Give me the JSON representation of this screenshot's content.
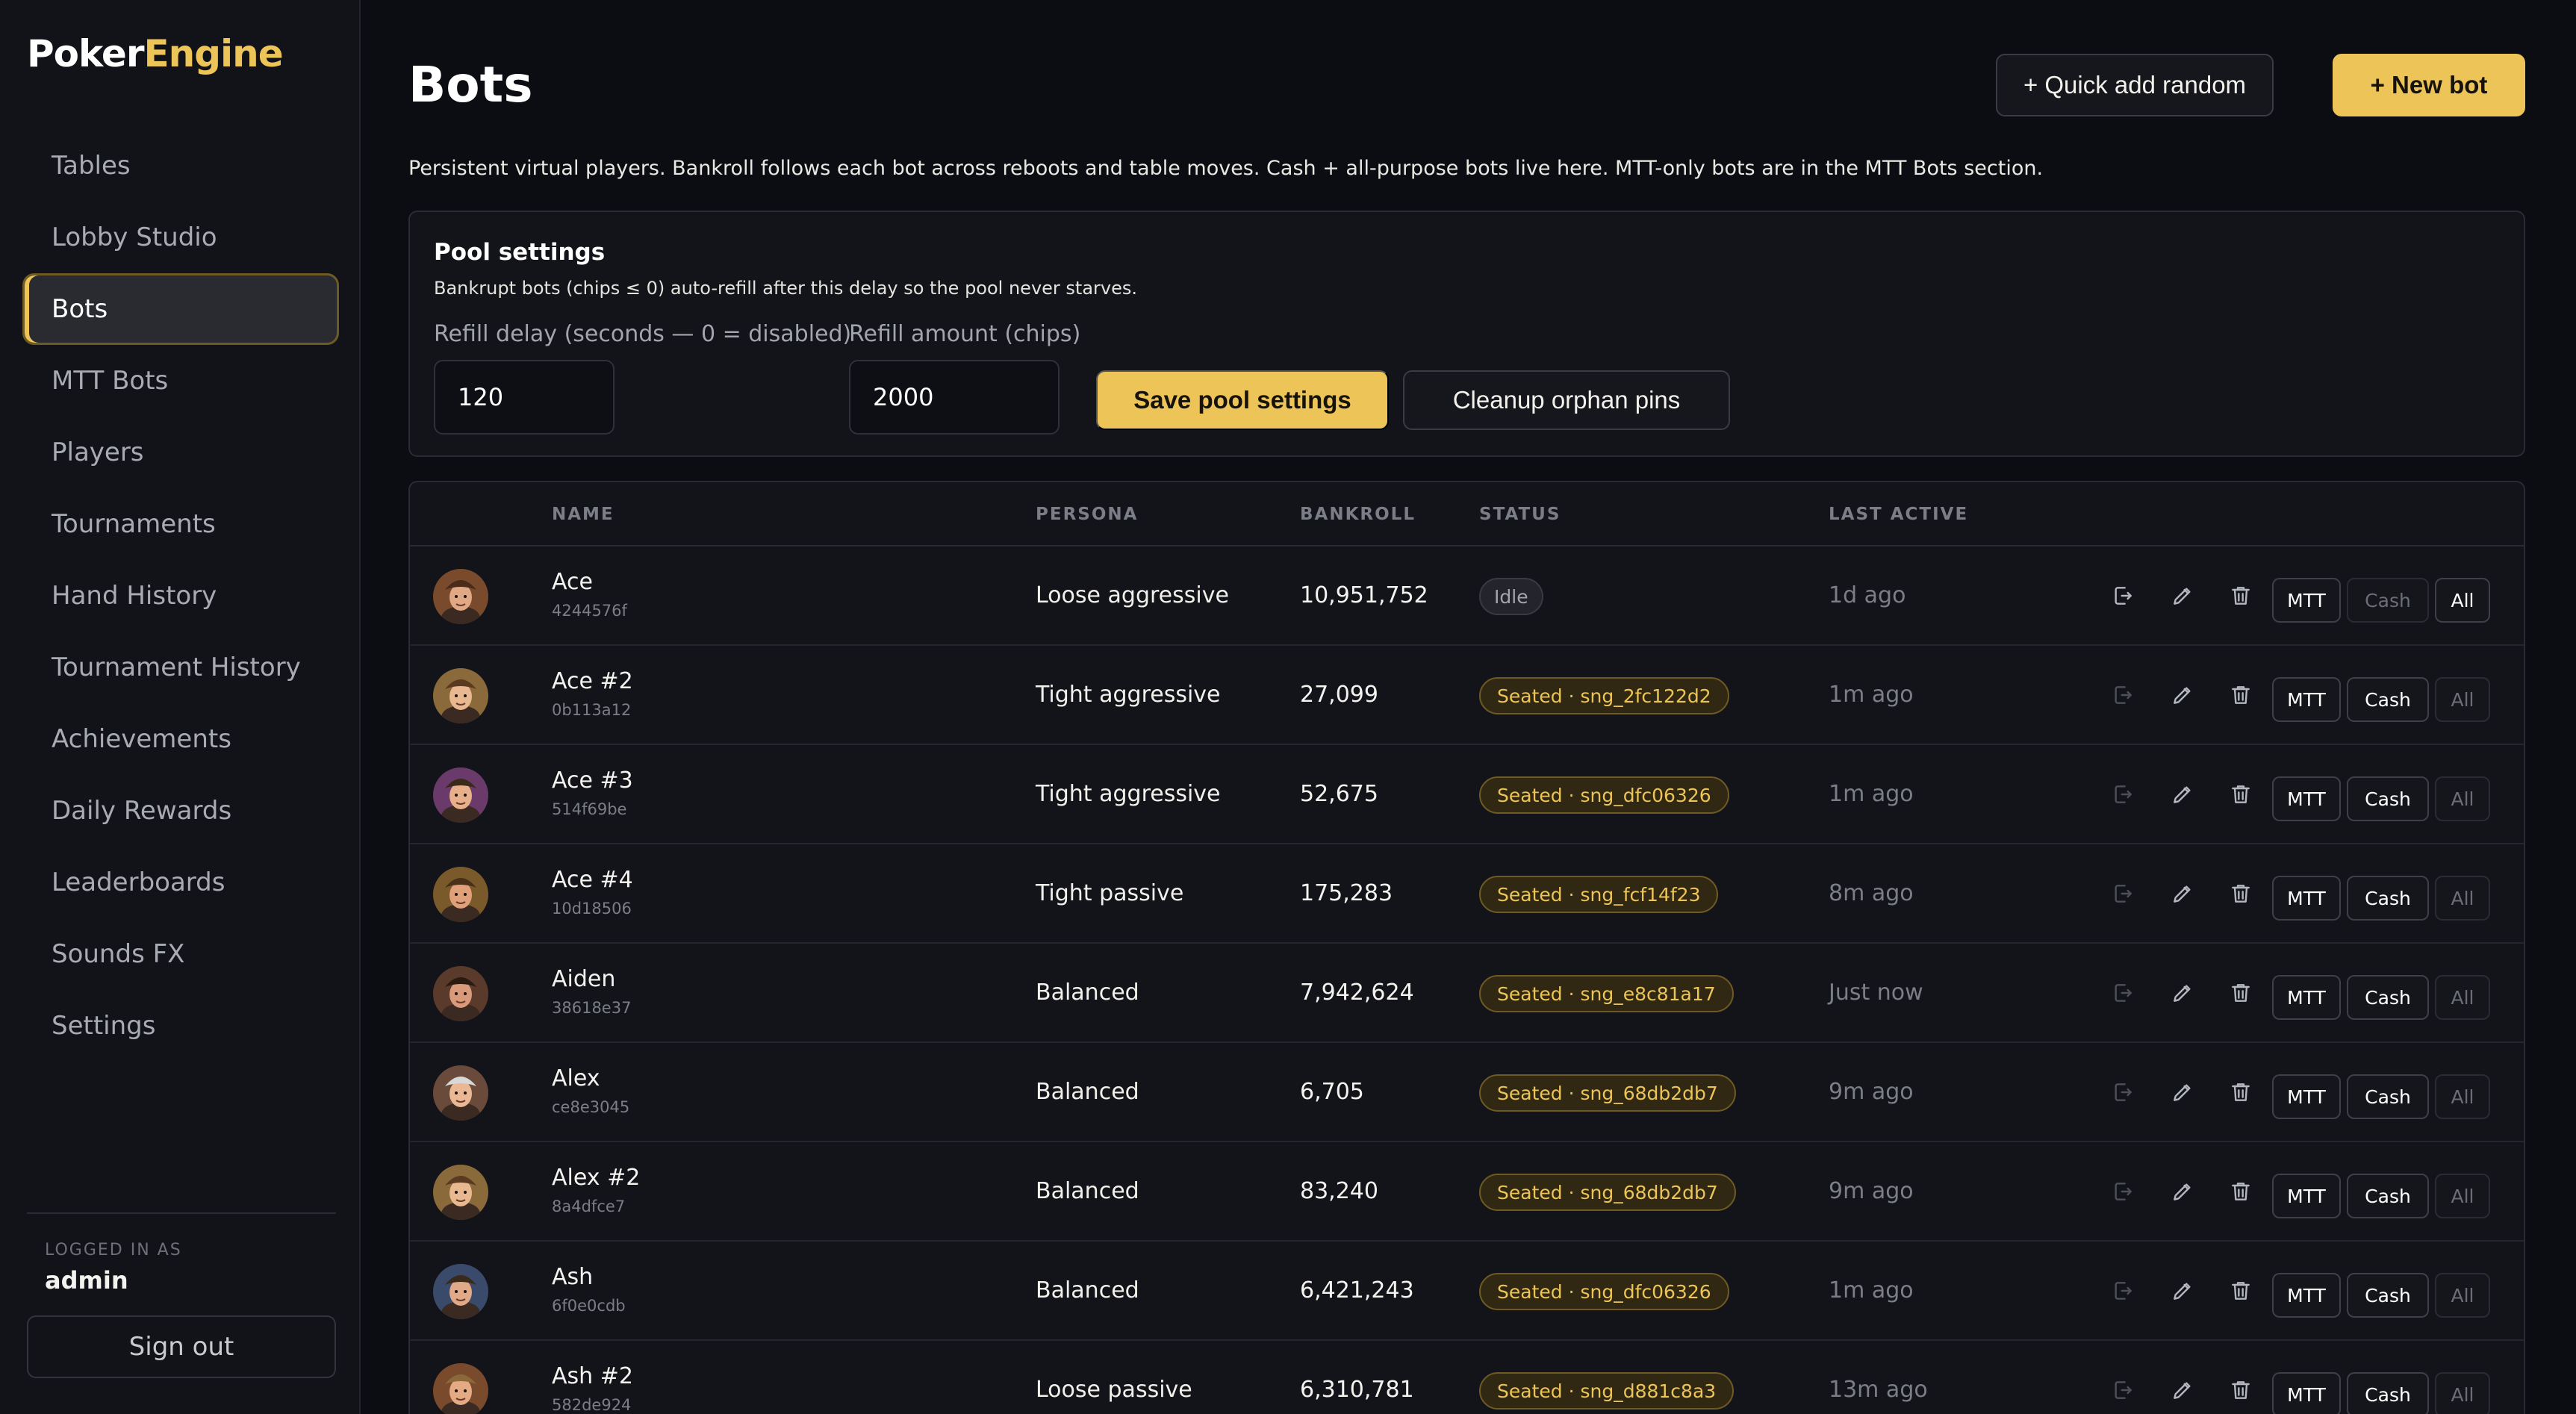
{
  "brand": {
    "part1": "Poker",
    "part2": "Engine"
  },
  "sidebar": {
    "items": [
      {
        "label": "Tables",
        "active": false
      },
      {
        "label": "Lobby Studio",
        "active": false
      },
      {
        "label": "Bots",
        "active": true
      },
      {
        "label": "MTT Bots",
        "active": false
      },
      {
        "label": "Players",
        "active": false
      },
      {
        "label": "Tournaments",
        "active": false
      },
      {
        "label": "Hand History",
        "active": false
      },
      {
        "label": "Tournament History",
        "active": false
      },
      {
        "label": "Achievements",
        "active": false
      },
      {
        "label": "Daily Rewards",
        "active": false
      },
      {
        "label": "Leaderboards",
        "active": false
      },
      {
        "label": "Sounds FX",
        "active": false
      },
      {
        "label": "Settings",
        "active": false
      }
    ],
    "login_label": "LOGGED IN AS",
    "username": "admin",
    "signout_label": "Sign out"
  },
  "header": {
    "title": "Bots",
    "quick_add_label": "+ Quick add random",
    "new_bot_label": "+ New bot",
    "description": "Persistent virtual players. Bankroll follows each bot across reboots and table moves. Cash + all-purpose bots live here. MTT-only bots are in the MTT Bots section."
  },
  "pool": {
    "title": "Pool settings",
    "description": "Bankrupt bots (chips ≤ 0) auto-refill after this delay so the pool never starves.",
    "refill_delay_label": "Refill delay (seconds — 0 = disabled)",
    "refill_delay_value": "120",
    "refill_amount_label": "Refill amount (chips)",
    "refill_amount_value": "2000",
    "save_label": "Save pool settings",
    "cleanup_label": "Cleanup orphan pins"
  },
  "table": {
    "columns": {
      "name": "NAME",
      "persona": "PERSONA",
      "bankroll": "BANKROLL",
      "status": "STATUS",
      "last_active": "LAST ACTIVE"
    },
    "scope_labels": {
      "mtt": "MTT",
      "cash": "Cash",
      "all": "All"
    },
    "rows": [
      {
        "name": "Ace",
        "id": "4244576f",
        "persona": "Loose aggressive",
        "bankroll": "10,951,752",
        "status": "Idle",
        "status_type": "idle",
        "last_active": "1d ago",
        "scope": "all"
      },
      {
        "name": "Ace #2",
        "id": "0b113a12",
        "persona": "Tight aggressive",
        "bankroll": "27,099",
        "status": "Seated · sng_2fc122d2",
        "status_type": "seated",
        "last_active": "1m ago",
        "scope": "cash"
      },
      {
        "name": "Ace #3",
        "id": "514f69be",
        "persona": "Tight aggressive",
        "bankroll": "52,675",
        "status": "Seated · sng_dfc06326",
        "status_type": "seated",
        "last_active": "1m ago",
        "scope": "cash"
      },
      {
        "name": "Ace #4",
        "id": "10d18506",
        "persona": "Tight passive",
        "bankroll": "175,283",
        "status": "Seated · sng_fcf14f23",
        "status_type": "seated",
        "last_active": "8m ago",
        "scope": "cash"
      },
      {
        "name": "Aiden",
        "id": "38618e37",
        "persona": "Balanced",
        "bankroll": "7,942,624",
        "status": "Seated · sng_e8c81a17",
        "status_type": "seated",
        "last_active": "Just now",
        "scope": "cash"
      },
      {
        "name": "Alex",
        "id": "ce8e3045",
        "persona": "Balanced",
        "bankroll": "6,705",
        "status": "Seated · sng_68db2db7",
        "status_type": "seated",
        "last_active": "9m ago",
        "scope": "cash"
      },
      {
        "name": "Alex #2",
        "id": "8a4dfce7",
        "persona": "Balanced",
        "bankroll": "83,240",
        "status": "Seated · sng_68db2db7",
        "status_type": "seated",
        "last_active": "9m ago",
        "scope": "cash"
      },
      {
        "name": "Ash",
        "id": "6f0e0cdb",
        "persona": "Balanced",
        "bankroll": "6,421,243",
        "status": "Seated · sng_dfc06326",
        "status_type": "seated",
        "last_active": "1m ago",
        "scope": "cash"
      },
      {
        "name": "Ash #2",
        "id": "582de924",
        "persona": "Loose passive",
        "bankroll": "6,310,781",
        "status": "Seated · sng_d881c8a3",
        "status_type": "seated",
        "last_active": "13m ago",
        "scope": "cash"
      }
    ]
  },
  "icons": {
    "row_actions": [
      "unseat-icon",
      "edit-icon",
      "trash-icon"
    ]
  },
  "colors": {
    "accent": "#ecc457",
    "background": "#0c0d12",
    "sidebar": "#121318",
    "card": "#13141a"
  }
}
